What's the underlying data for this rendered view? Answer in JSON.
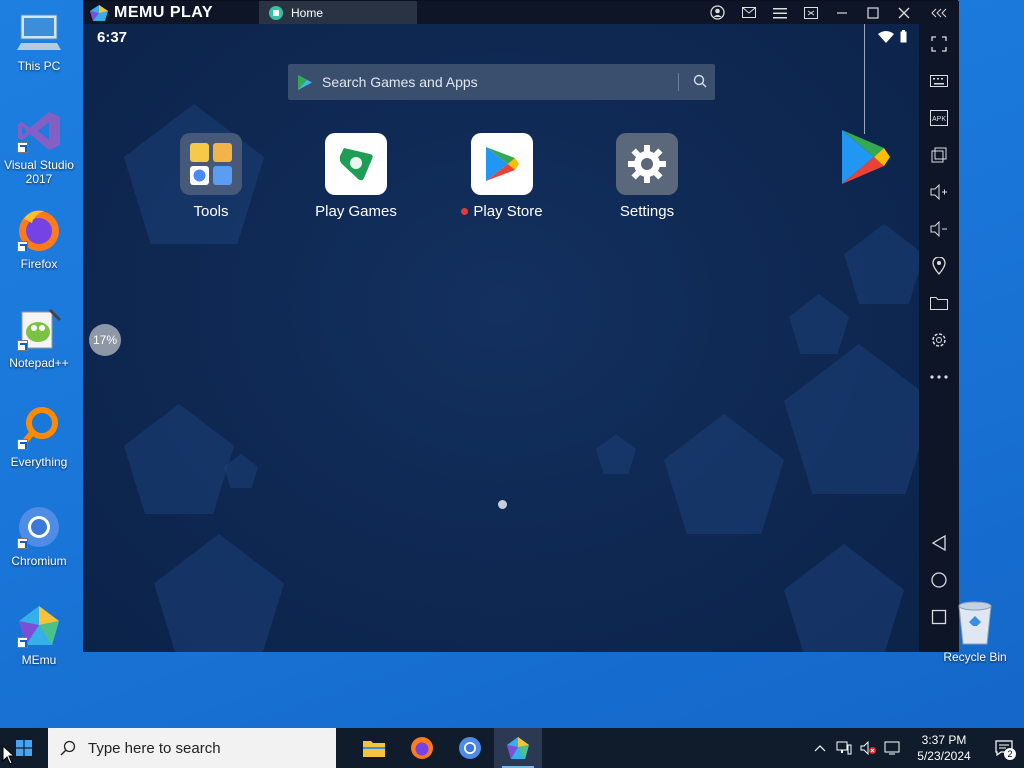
{
  "desktop": {
    "icons": [
      {
        "label": "This PC",
        "icon": "computer-icon"
      },
      {
        "label": "Visual Studio 2017",
        "icon": "visual-studio-icon"
      },
      {
        "label": "Firefox",
        "icon": "firefox-icon"
      },
      {
        "label": "Notepad++",
        "icon": "notepadpp-icon"
      },
      {
        "label": "Everything",
        "icon": "everything-icon"
      },
      {
        "label": "Chromium",
        "icon": "chromium-icon"
      },
      {
        "label": "MEmu",
        "icon": "memu-icon"
      }
    ],
    "recycle_bin": {
      "label": "Recycle Bin",
      "icon": "recycle-bin-icon"
    }
  },
  "emulator": {
    "brand": "MEMU PLAY",
    "tab_label": "Home",
    "status_time": "6:37",
    "search_placeholder": "Search Games and Apps",
    "apps": [
      {
        "label": "Tools",
        "icon": "tools-folder-icon"
      },
      {
        "label": "Play Games",
        "icon": "play-games-icon"
      },
      {
        "label": "Play Store",
        "icon": "play-store-icon",
        "has_notification": true
      },
      {
        "label": "Settings",
        "icon": "settings-gear-icon"
      }
    ],
    "loader_percent": "17%",
    "sidebar_tools": [
      "fullscreen-icon",
      "keyboard-icon",
      "apk-icon",
      "multi-window-icon",
      "volume-up-icon",
      "volume-down-icon",
      "location-icon",
      "folder-icon",
      "settings-icon",
      "more-icon",
      "back-icon",
      "home-icon",
      "recents-icon"
    ],
    "apk_label": "APK"
  },
  "taskbar": {
    "search_placeholder": "Type here to search",
    "time": "3:37 PM",
    "date": "5/23/2024",
    "notification_count": "2"
  },
  "colors": {
    "desktop": "#1a78da",
    "emulator_bg": "#0f2a55",
    "taskbar": "#101c2c"
  }
}
